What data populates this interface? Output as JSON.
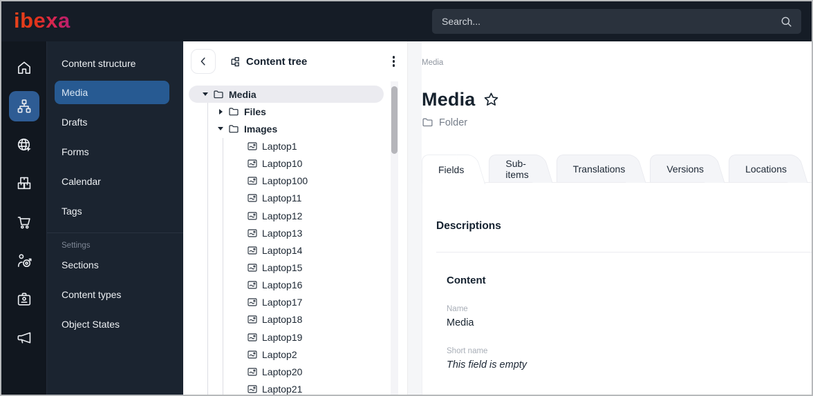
{
  "topbar": {
    "logo_text": "ibexa",
    "search_placeholder": "Search..."
  },
  "icon_rail": {
    "items": [
      {
        "icon": "home-icon",
        "active": false
      },
      {
        "icon": "content-structure-icon",
        "active": true
      },
      {
        "icon": "site-globe-icon",
        "active": false
      },
      {
        "icon": "products-boxes-icon",
        "active": false
      },
      {
        "icon": "commerce-cart-icon",
        "active": false
      },
      {
        "icon": "personalization-target-icon",
        "active": false
      },
      {
        "icon": "admin-badge-icon",
        "active": false
      },
      {
        "icon": "promotions-megaphone-icon",
        "active": false
      }
    ]
  },
  "sidebar": {
    "items": [
      {
        "label": "Content structure",
        "selected": false
      },
      {
        "label": "Media",
        "selected": true
      },
      {
        "label": "Drafts",
        "selected": false
      },
      {
        "label": "Forms",
        "selected": false
      },
      {
        "label": "Calendar",
        "selected": false
      },
      {
        "label": "Tags",
        "selected": false
      }
    ],
    "settings_label": "Settings",
    "settings_items": [
      {
        "label": "Sections"
      },
      {
        "label": "Content types"
      },
      {
        "label": "Object States"
      }
    ]
  },
  "tree_panel": {
    "title": "Content tree",
    "root": {
      "label": "Media",
      "state": "expanded",
      "selected": true
    },
    "folders": [
      {
        "label": "Files",
        "state": "collapsed"
      },
      {
        "label": "Images",
        "state": "expanded"
      }
    ],
    "image_items": [
      "Laptop1",
      "Laptop10",
      "Laptop100",
      "Laptop11",
      "Laptop12",
      "Laptop13",
      "Laptop14",
      "Laptop15",
      "Laptop16",
      "Laptop17",
      "Laptop18",
      "Laptop19",
      "Laptop2",
      "Laptop20",
      "Laptop21"
    ]
  },
  "main": {
    "breadcrumb": "Media",
    "page_title": "Media",
    "content_type_label": "Folder",
    "tabs": [
      {
        "label": "Fields",
        "active": true
      },
      {
        "label": "Sub-items",
        "active": false
      },
      {
        "label": "Translations",
        "active": false
      },
      {
        "label": "Versions",
        "active": false
      },
      {
        "label": "Locations",
        "active": false
      }
    ],
    "fields_section": {
      "heading": "Descriptions",
      "group_heading": "Content",
      "fields": [
        {
          "label": "Name",
          "value": "Media",
          "empty": false
        },
        {
          "label": "Short name",
          "value": "This field is empty",
          "empty": true
        }
      ]
    }
  },
  "colors": {
    "topbar_bg": "#151c26",
    "rail_bg": "#11171f",
    "menu_bg": "#1b2430",
    "selected_blue": "#275a92",
    "active_icon_blue": "#2e5c94",
    "logo_gradient_start": "#e8431d",
    "logo_gradient_end": "#b41e6e",
    "selected_tree_row": "#ebebf0"
  }
}
